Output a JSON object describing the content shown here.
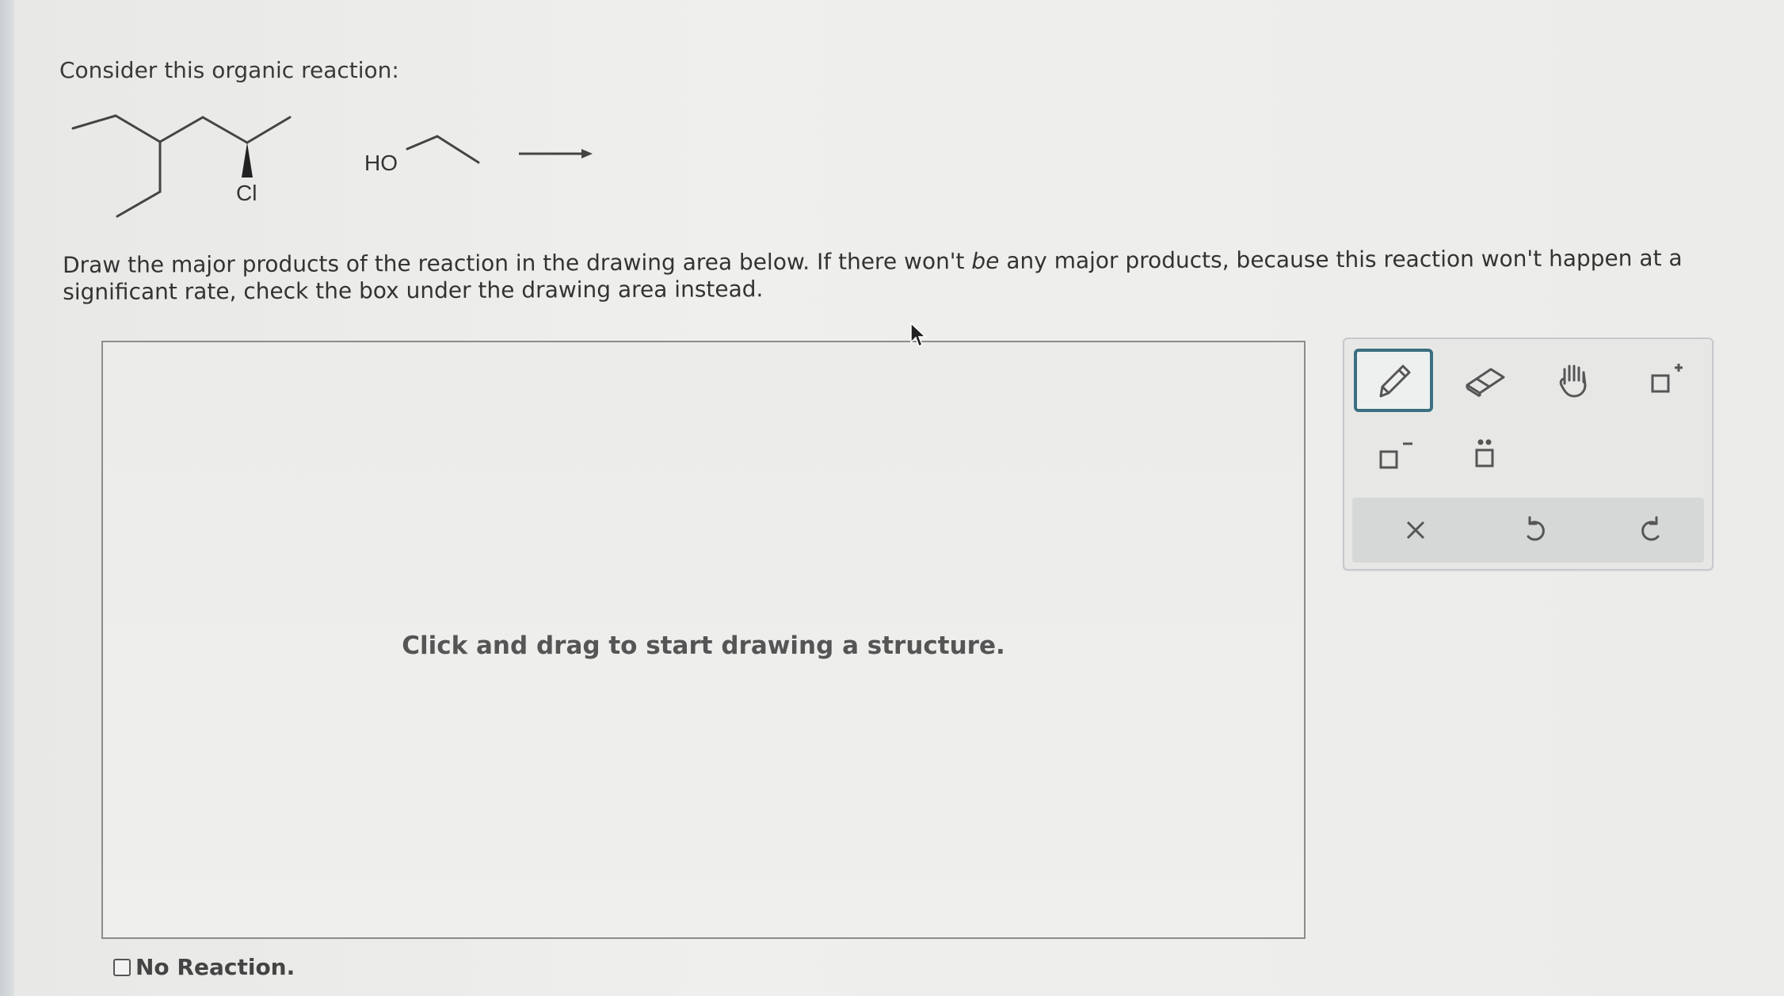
{
  "question": {
    "prompt": "Consider this organic reaction:",
    "instructions_before": "Draw the major products of the reaction in the drawing area below. If there won't ",
    "instructions_emphasis": "be",
    "instructions_after": " any major products, because this reaction won't happen at a significant rate, check the box under the drawing area instead."
  },
  "reaction": {
    "reactant1_label": "Cl",
    "reactant2_label": "HO"
  },
  "drawing_area": {
    "hint": "Click and drag to start drawing a structure."
  },
  "toolbar": {
    "tools": [
      "pencil-icon",
      "eraser-icon",
      "hand-icon",
      "positive-charge-icon",
      "negative-charge-icon",
      "lone-pair-icon"
    ],
    "active_tool": "pencil-icon",
    "actions": [
      "clear-icon",
      "undo-icon",
      "redo-icon"
    ]
  },
  "no_reaction": {
    "label": "No Reaction.",
    "checked": false
  }
}
